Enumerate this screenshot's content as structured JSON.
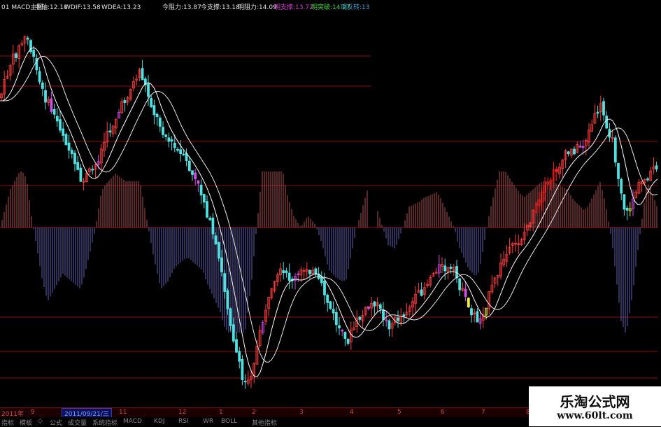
{
  "header": {
    "main_label": "01 MACD主图",
    "items": [
      {
        "label": "中轴:",
        "value": "12.10",
        "color": "#e0e0e0"
      },
      {
        "label": "WDIF:",
        "value": "13.58",
        "color": "#e0e0e0"
      },
      {
        "label": "WDEA:",
        "value": "13.23",
        "color": "#e0e0e0"
      },
      {
        "label": "今阻力:",
        "value": "13.87",
        "color": "#e0e0e0"
      },
      {
        "label": "今支撑:",
        "value": "13.18",
        "color": "#e0e0e0"
      },
      {
        "label": "明阻力:",
        "value": "14.09",
        "color": "#e0e0e0"
      },
      {
        "label": "明支撑:",
        "value": "13.72",
        "color": "#d040d0"
      },
      {
        "label": "明突破:",
        "value": "14.27",
        "color": "#40d040"
      },
      {
        "label": "明反转:",
        "value": "13",
        "color": "#40a0d0"
      }
    ]
  },
  "axis": {
    "labels": [
      "2011年",
      "9",
      "2011/09/21/三",
      "11",
      "12",
      "1",
      "2",
      "3",
      "4",
      "5",
      "6",
      "7",
      "8"
    ]
  },
  "bottom": {
    "items": [
      "指标",
      "模板",
      "◇",
      "公式",
      "成交量",
      "系统指标",
      "MACD",
      "KDJ",
      "RSI",
      "WR",
      "BOLL",
      "其他指标"
    ]
  },
  "watermark": {
    "title": "乐淘公式网",
    "url": "www.60lt.com"
  },
  "colors": {
    "up": "#ff4040",
    "down": "#50e0e0",
    "hist_pos": "#b05050",
    "hist_neg": "#6060b0",
    "line": "#ffffff",
    "grid": "#8a1010"
  }
}
